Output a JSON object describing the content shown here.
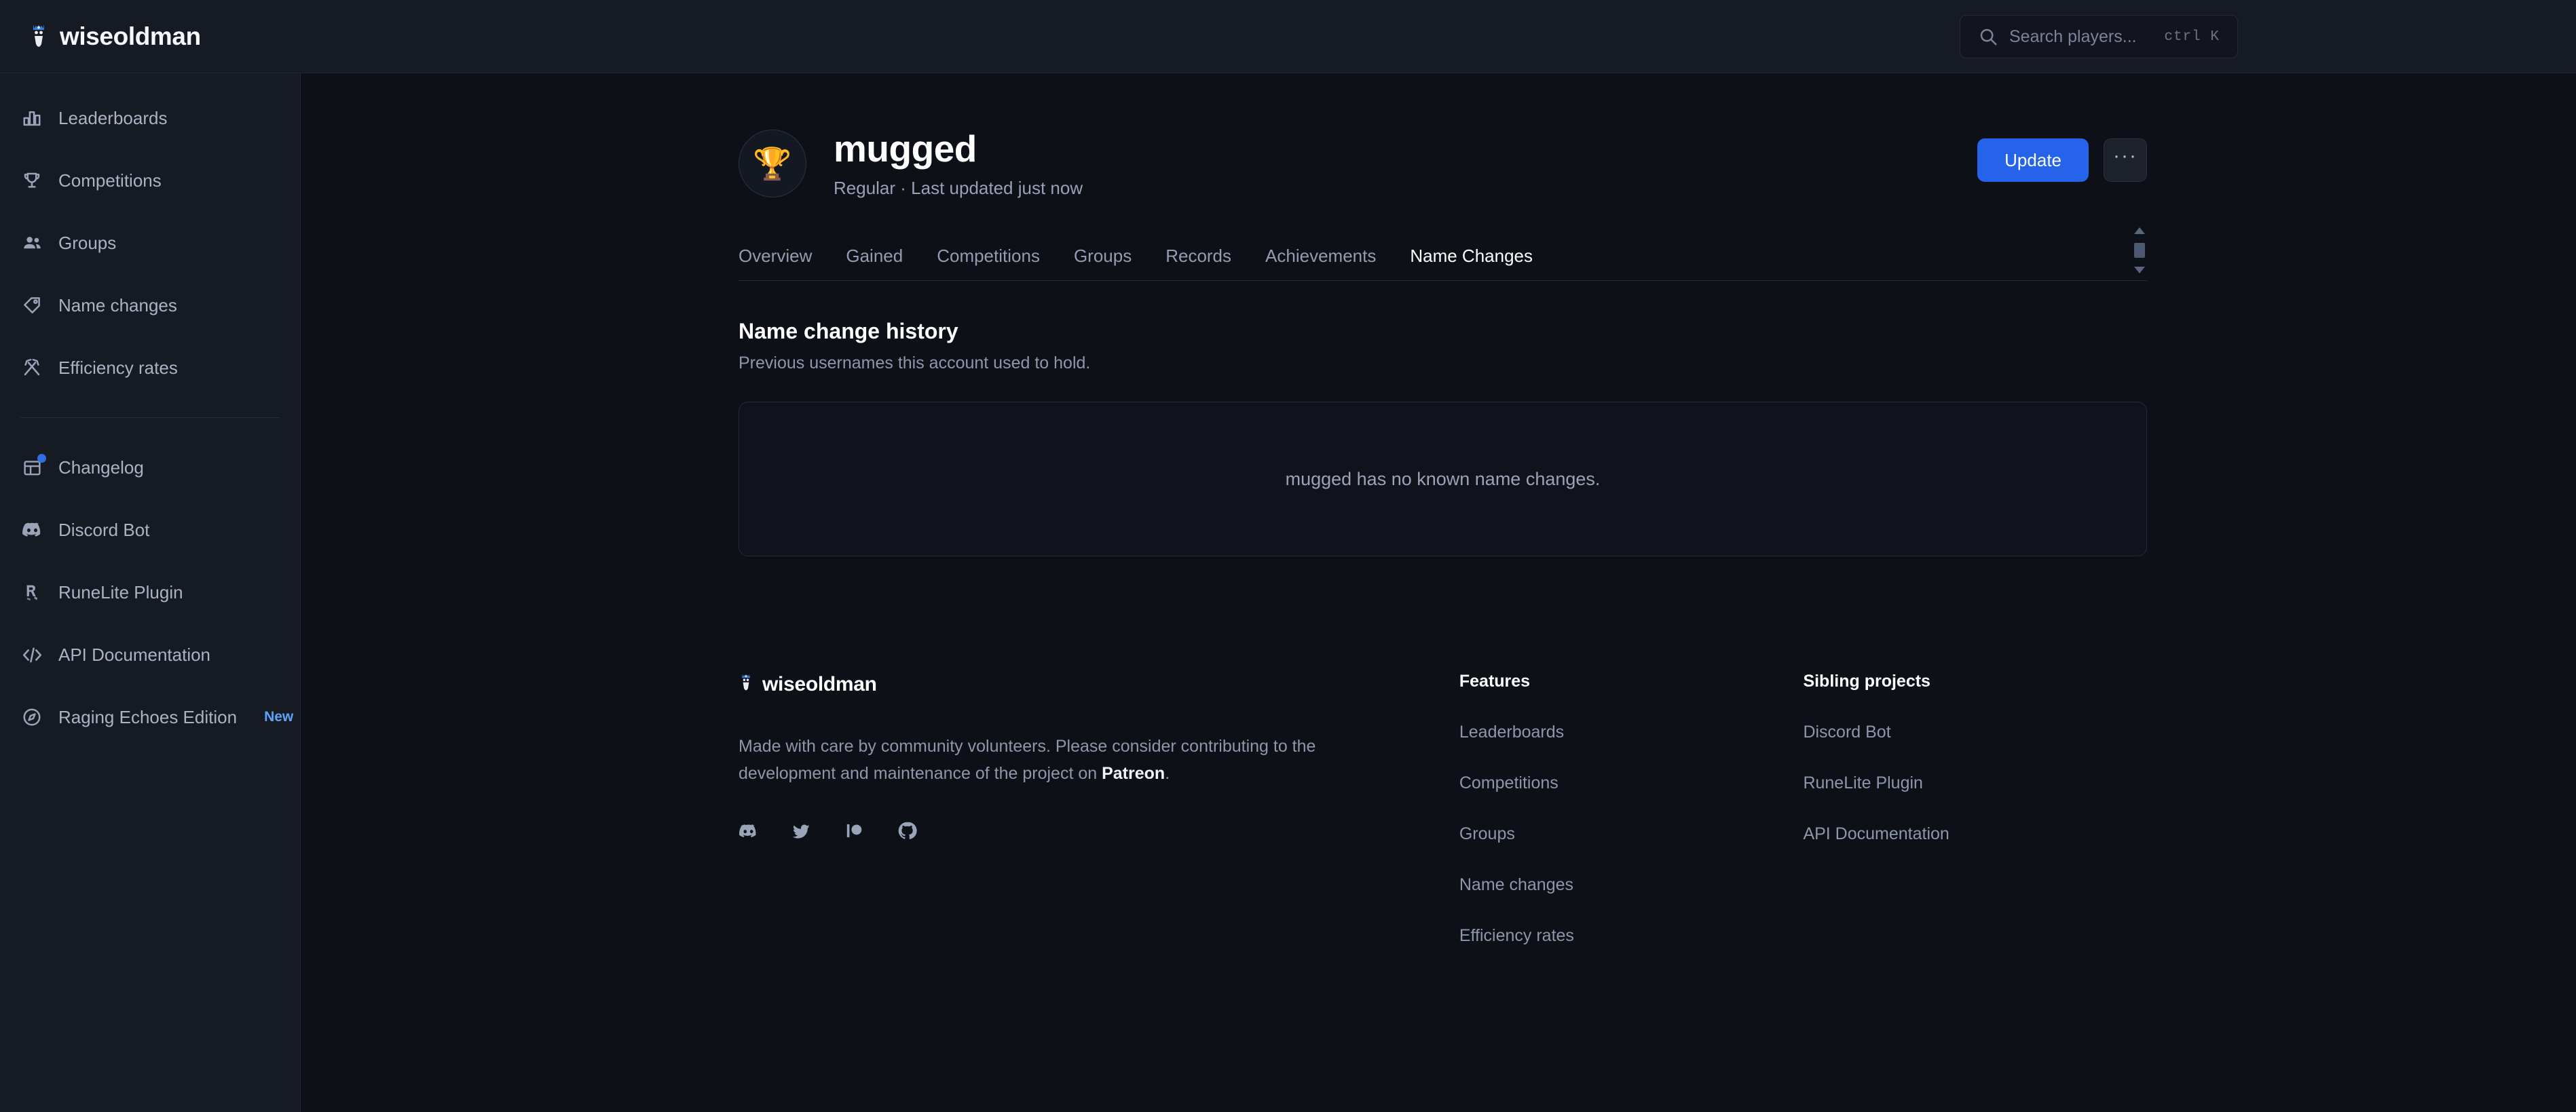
{
  "header": {
    "brand": "wiseoldman",
    "brand_logo_icon": "wiseoldman-logo-icon",
    "search": {
      "icon": "search-icon",
      "placeholder": "Search players...",
      "shortcut": "ctrl K"
    }
  },
  "sidebar": {
    "primary": [
      {
        "label": "Leaderboards",
        "icon": "bar-chart-icon"
      },
      {
        "label": "Competitions",
        "icon": "trophy-icon"
      },
      {
        "label": "Groups",
        "icon": "people-icon"
      },
      {
        "label": "Name changes",
        "icon": "tag-icon"
      },
      {
        "label": "Efficiency rates",
        "icon": "hammer-pickaxe-icon"
      }
    ],
    "secondary": [
      {
        "label": "Changelog",
        "icon": "changelog-icon",
        "dot": true
      },
      {
        "label": "Discord Bot",
        "icon": "discord-icon"
      },
      {
        "label": "RuneLite Plugin",
        "icon": "runelite-icon"
      },
      {
        "label": "API Documentation",
        "icon": "code-brackets-icon"
      },
      {
        "label": "Raging Echoes Edition",
        "icon": "compass-icon",
        "badge": "New"
      }
    ]
  },
  "player": {
    "avatar_icon": "trophy-emoji",
    "avatar_glyph": "🏆",
    "name": "mugged",
    "subtitle": "Regular · Last updated just now",
    "update_label": "Update",
    "more_label": "···"
  },
  "tabs": [
    {
      "label": "Overview",
      "active": false
    },
    {
      "label": "Gained",
      "active": false
    },
    {
      "label": "Competitions",
      "active": false
    },
    {
      "label": "Groups",
      "active": false
    },
    {
      "label": "Records",
      "active": false
    },
    {
      "label": "Achievements",
      "active": false
    },
    {
      "label": "Name Changes",
      "active": true
    }
  ],
  "section": {
    "title": "Name change history",
    "description": "Previous usernames this account used to hold.",
    "empty_message": "mugged has no known name changes."
  },
  "footer": {
    "brand": "wiseoldman",
    "brand_logo_icon": "wiseoldman-logo-icon",
    "text_before": "Made with care by community volunteers. Please consider contributing to the development and maintenance of the project on ",
    "text_link": "Patreon",
    "text_after": ".",
    "socials": [
      {
        "icon": "discord-icon"
      },
      {
        "icon": "twitter-icon"
      },
      {
        "icon": "patreon-icon"
      },
      {
        "icon": "github-icon"
      }
    ],
    "columns": [
      {
        "title": "Features",
        "links": [
          "Leaderboards",
          "Competitions",
          "Groups",
          "Name changes",
          "Efficiency rates"
        ]
      },
      {
        "title": "Sibling projects",
        "links": [
          "Discord Bot",
          "RuneLite Plugin",
          "API Documentation"
        ]
      }
    ]
  },
  "colors": {
    "accent": "#2563eb",
    "badge_new": "#5fa3f8",
    "page_bg": "#0d1017",
    "sidebar_bg": "#161a23"
  }
}
